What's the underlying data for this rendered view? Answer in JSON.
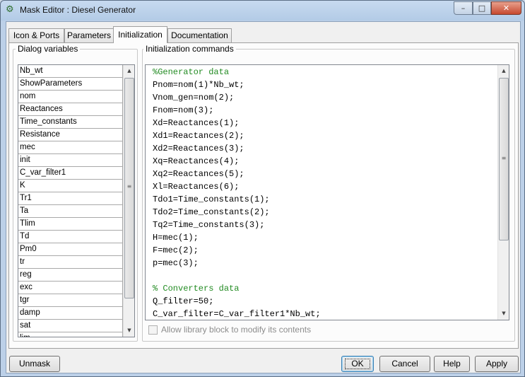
{
  "window": {
    "title": "Mask Editor : Diesel Generator",
    "controls": {
      "minimize": "–",
      "maximize": "□",
      "close": "✕"
    },
    "title_icon": "matlab-block-icon"
  },
  "tabs": [
    {
      "label": "Icon & Ports",
      "active": false
    },
    {
      "label": "Parameters",
      "active": false
    },
    {
      "label": "Initialization",
      "active": true
    },
    {
      "label": "Documentation",
      "active": false
    }
  ],
  "dialog_variables": {
    "header": "Dialog variables",
    "items": [
      "Nb_wt",
      "ShowParameters",
      "nom",
      "Reactances",
      "Time_constants",
      "Resistance",
      "mec",
      "init",
      "C_var_filter1",
      "K",
      "Tr1",
      "Ta",
      "Tlim",
      "Td",
      "Pm0",
      "tr",
      "reg",
      "exc",
      "tgr",
      "damp",
      "sat",
      "lim"
    ]
  },
  "init_commands": {
    "header": "Initialization commands",
    "lines": [
      {
        "text": "%Generator data",
        "comment": true
      },
      {
        "text": "Pnom=nom(1)*Nb_wt;",
        "comment": false
      },
      {
        "text": "Vnom_gen=nom(2);",
        "comment": false
      },
      {
        "text": "Fnom=nom(3);",
        "comment": false
      },
      {
        "text": "Xd=Reactances(1);",
        "comment": false
      },
      {
        "text": "Xd1=Reactances(2);",
        "comment": false
      },
      {
        "text": "Xd2=Reactances(3);",
        "comment": false
      },
      {
        "text": "Xq=Reactances(4);",
        "comment": false
      },
      {
        "text": "Xq2=Reactances(5);",
        "comment": false
      },
      {
        "text": "Xl=Reactances(6);",
        "comment": false
      },
      {
        "text": "Tdo1=Time_constants(1);",
        "comment": false
      },
      {
        "text": "Tdo2=Time_constants(2);",
        "comment": false
      },
      {
        "text": "Tq2=Time_constants(3);",
        "comment": false
      },
      {
        "text": "H=mec(1);",
        "comment": false
      },
      {
        "text": "F=mec(2);",
        "comment": false
      },
      {
        "text": "p=mec(3);",
        "comment": false
      },
      {
        "text": "",
        "comment": false
      },
      {
        "text": "% Converters data",
        "comment": true
      },
      {
        "text": "Q_filter=50;",
        "comment": false
      },
      {
        "text": "C_var_filter=C_var_filter1*Nb_wt;",
        "comment": false
      }
    ]
  },
  "allow_library_checkbox": {
    "label": "Allow library block to modify its contents",
    "checked": false,
    "enabled": false
  },
  "scroll_glyphs": {
    "up": "▲",
    "down": "▼",
    "grip": "≡"
  },
  "buttons": {
    "unmask": "Unmask",
    "ok": "OK",
    "cancel": "Cancel",
    "help": "Help",
    "apply": "Apply"
  }
}
